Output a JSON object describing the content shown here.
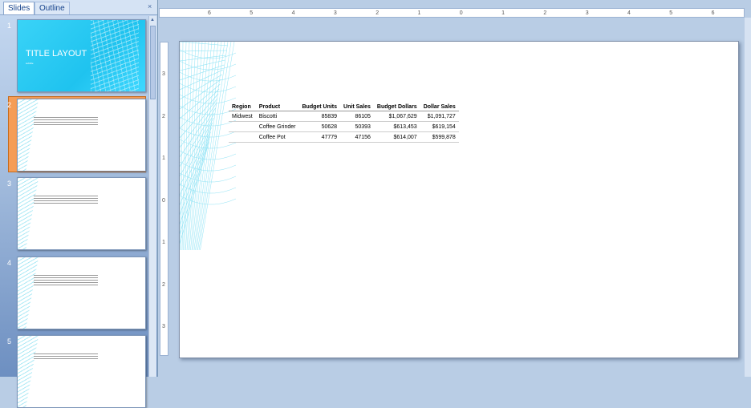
{
  "pane": {
    "tabs": [
      {
        "label": "Slides"
      },
      {
        "label": "Outline"
      }
    ],
    "close_icon": "×",
    "slides": [
      {
        "number": "1",
        "title": "TITLE LAYOUT",
        "subtitle": "subtitle"
      },
      {
        "number": "2"
      },
      {
        "number": "3"
      },
      {
        "number": "4"
      },
      {
        "number": "5"
      }
    ]
  },
  "ruler": {
    "h_labels": [
      "6",
      "5",
      "4",
      "3",
      "2",
      "1",
      "0",
      "1",
      "2",
      "3",
      "4",
      "5",
      "6"
    ],
    "v_labels": [
      "3",
      "2",
      "1",
      "0",
      "1",
      "2",
      "3"
    ]
  },
  "slide": {
    "table": {
      "headers": [
        "Region",
        "Product",
        "Budget Units",
        "Unit Sales",
        "Budget Dollars",
        "Dollar Sales"
      ],
      "rows": [
        [
          "Midwest",
          "Biscotti",
          "85839",
          "86105",
          "$1,067,629",
          "$1,091,727"
        ],
        [
          "",
          "Coffee Grinder",
          "50628",
          "50393",
          "$613,453",
          "$619,154"
        ],
        [
          "",
          "Coffee Pot",
          "47779",
          "47156",
          "$614,007",
          "$599,878"
        ]
      ]
    }
  },
  "colors": {
    "accent_cyan": "#1fc3ef",
    "selection_orange": "#f59d56",
    "pane_blue": "#6d8fc1"
  }
}
